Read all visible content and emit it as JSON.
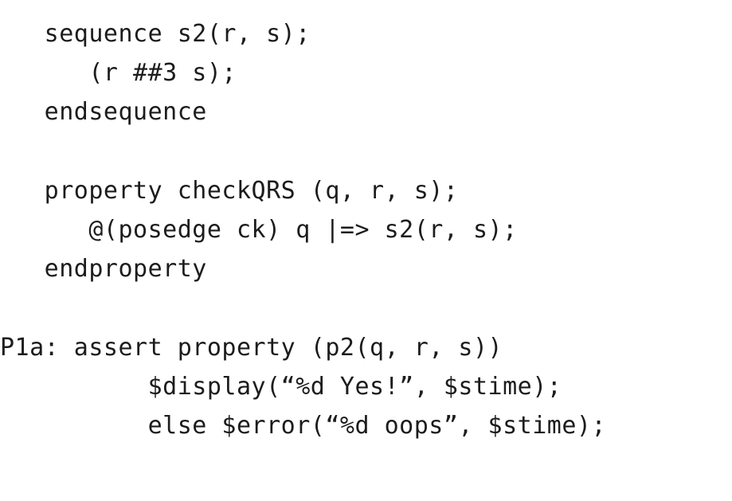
{
  "code": {
    "lines": [
      "   sequence s2(r, s);",
      "      (r ##3 s);",
      "   endsequence",
      "",
      "   property checkQRS (q, r, s);",
      "      @(posedge ck) q |=> s2(r, s);",
      "   endproperty",
      "",
      "P1a: assert property (p2(q, r, s))",
      "          $display(“%d Yes!”, $stime);",
      "          else $error(“%d oops”, $stime);"
    ]
  }
}
